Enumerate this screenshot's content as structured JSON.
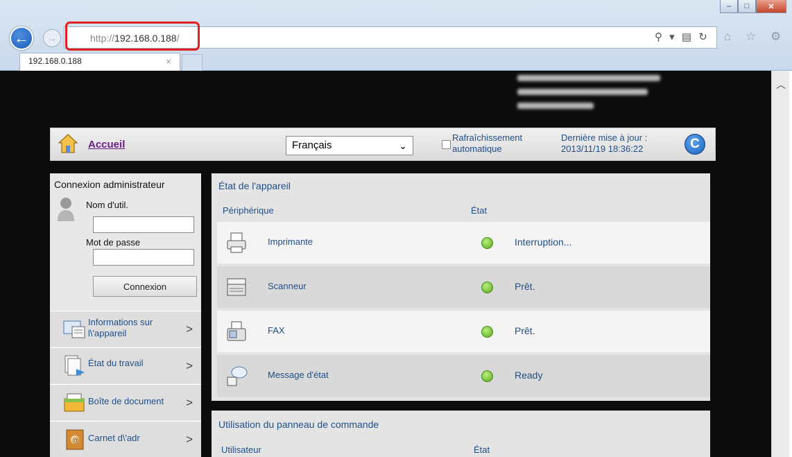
{
  "browser": {
    "url_prefix": "http://",
    "url_host": "192.168.0.188",
    "url_suffix": "/",
    "tab_title": "192.168.0.188",
    "tab_close": "×",
    "addr_tools": "⚲ ▾ ▤ ↻",
    "nav_tools": "⌂ ☆ ⚙"
  },
  "topbar": {
    "home_label": "Accueil",
    "language": "Français",
    "auto_refresh_line1": "Rafraîchissement",
    "auto_refresh_line2": "automatique",
    "last_update_line1": "Dernière mise à jour :",
    "last_update_line2": "2013/11/19 18:36:22"
  },
  "login": {
    "title": "Connexion administrateur",
    "user_label": "Nom d'util.",
    "password_label": "Mot de passe",
    "button_label": "Connexion"
  },
  "nav": {
    "items": [
      {
        "line1": "Informations sur",
        "line2": "l\\'appareil"
      },
      {
        "line1": "État du travail",
        "line2": ""
      },
      {
        "line1": "Boîte de document",
        "line2": ""
      },
      {
        "line1": "Carnet d\\'adr",
        "line2": ""
      }
    ]
  },
  "device_status": {
    "title": "État de l'appareil",
    "col_device": "Périphérique",
    "col_state": "État",
    "rows": [
      {
        "name": "Imprimante",
        "state": "Interruption..."
      },
      {
        "name": "Scanneur",
        "state": "Prêt."
      },
      {
        "name": "FAX",
        "state": "Prêt."
      },
      {
        "name": "Message d'état",
        "state": "Ready"
      }
    ]
  },
  "panel_usage": {
    "title": "Utilisation du panneau de commande",
    "col_user": "Utilisateur",
    "col_state": "État"
  },
  "colors": {
    "status_ok": "#5aa81d",
    "link": "#1f4e89",
    "home_link": "#6a1d87",
    "highlight": "#e0201c"
  }
}
